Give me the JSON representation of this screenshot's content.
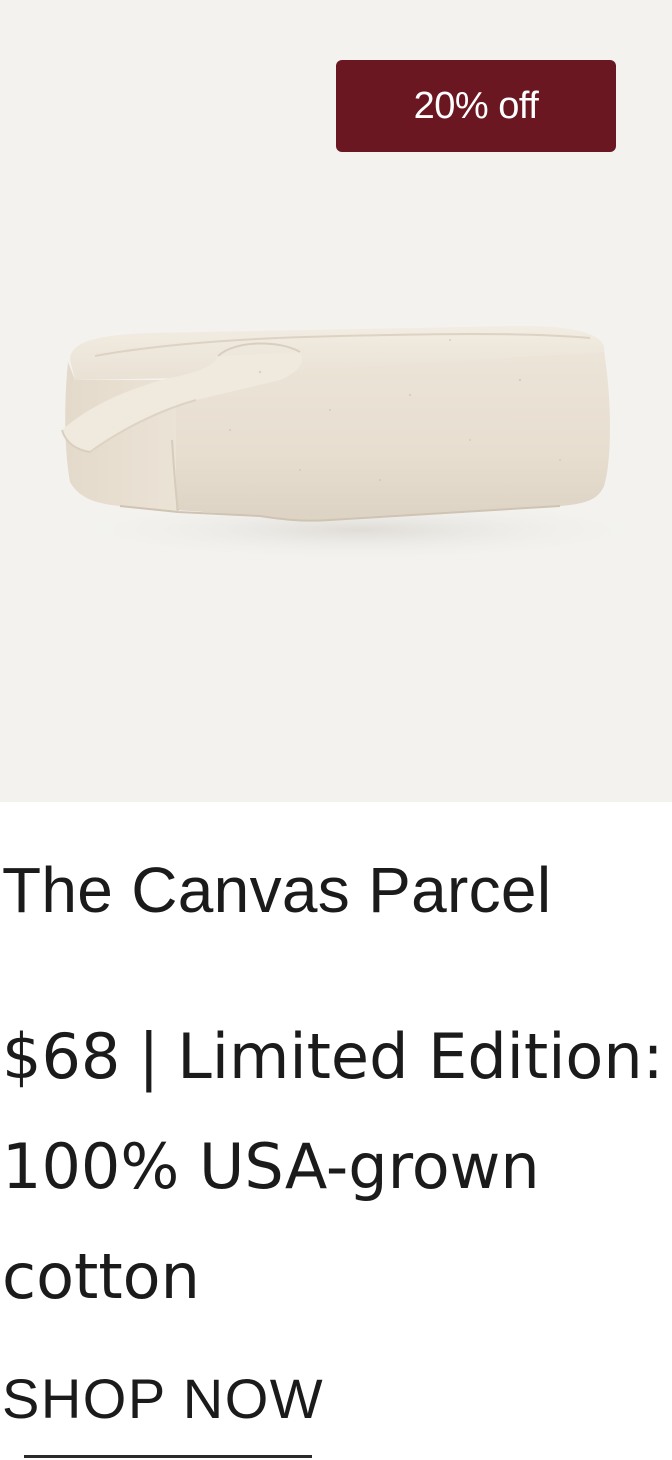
{
  "badge": {
    "text": "20% off"
  },
  "product": {
    "title": "The Canvas Parcel",
    "price": "$68",
    "separator": "|",
    "description": "Limited Edition: 100% USA-grown cotton"
  },
  "cta": {
    "label": "SHOP NOW"
  },
  "colors": {
    "badge_background": "#6a1722",
    "image_background": "#f3f2ef",
    "text": "#1b1b1b"
  },
  "icons": {
    "product_image": "canvas-pouch-image"
  }
}
